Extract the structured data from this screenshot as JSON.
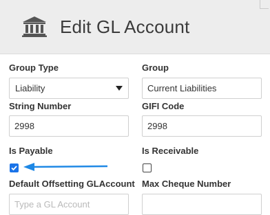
{
  "header": {
    "title": "Edit GL Account",
    "icon": "bank-icon"
  },
  "form": {
    "group_type": {
      "label": "Group Type",
      "value": "Liability"
    },
    "group": {
      "label": "Group",
      "value": "Current Liabilities"
    },
    "string_number": {
      "label": "String Number",
      "value": "2998"
    },
    "gifi_code": {
      "label": "GIFI Code",
      "value": "2998"
    },
    "is_payable": {
      "label": "Is Payable",
      "checked": true
    },
    "is_receivable": {
      "label": "Is Receivable",
      "checked": false
    },
    "default_offsetting": {
      "label": "Default Offsetting GLAccount",
      "placeholder": "Type a GL Account"
    },
    "max_cheque_number": {
      "label": "Max Cheque Number",
      "value": ""
    }
  },
  "colors": {
    "accent": "#1a73e8",
    "arrow": "#1e88e5",
    "header_bg": "#ededed"
  }
}
